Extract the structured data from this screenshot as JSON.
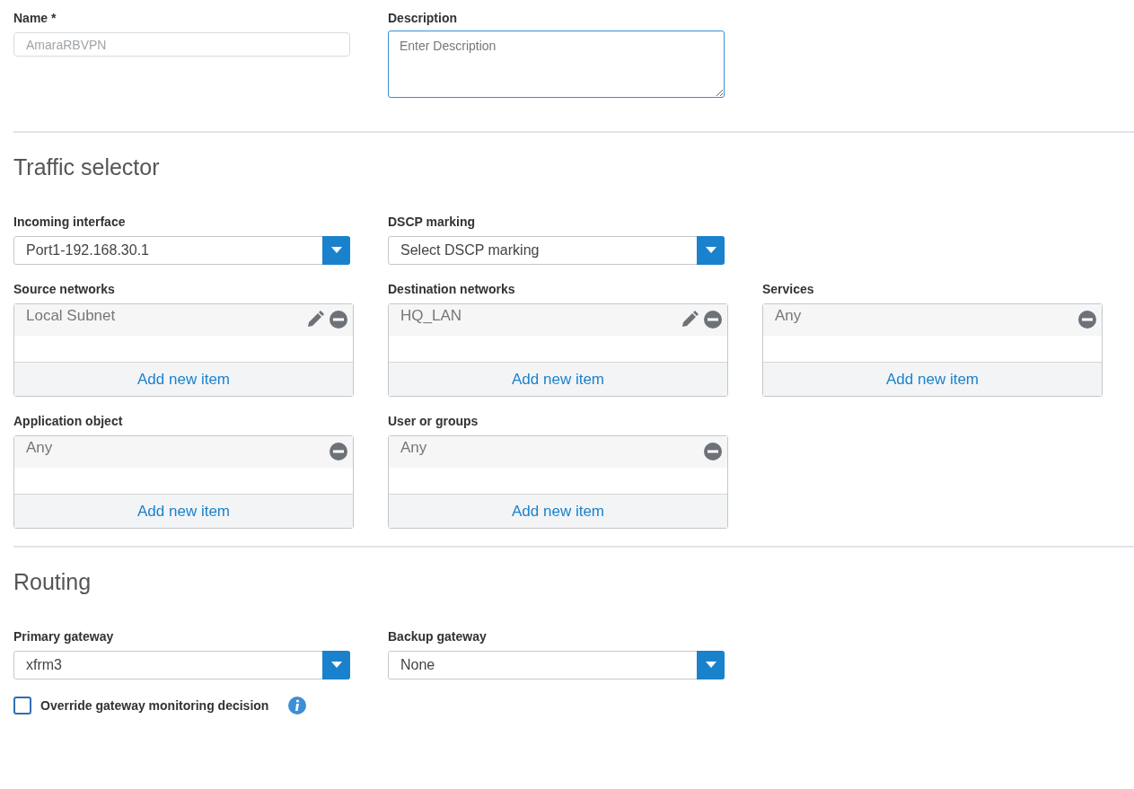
{
  "general": {
    "name": {
      "label": "Name *",
      "value": "AmaraRBVPN",
      "disabled": true
    },
    "description": {
      "label": "Description",
      "placeholder": "Enter Description",
      "focused": true
    }
  },
  "sections": [
    {
      "title": "Traffic selector",
      "rows": [
        [
          {
            "kind": "select",
            "label": "Incoming interface",
            "value": "Port1-192.168.30.1"
          },
          {
            "kind": "select",
            "label": "DSCP marking",
            "value": "Select DSCP marking"
          }
        ],
        [
          {
            "kind": "list",
            "label": "Source networks",
            "items": [
              {
                "text": "Local Subnet",
                "editable": true
              }
            ],
            "add_label": "Add new item"
          },
          {
            "kind": "list",
            "label": "Destination networks",
            "items": [
              {
                "text": "HQ_LAN",
                "editable": true
              }
            ],
            "add_label": "Add new item"
          },
          {
            "kind": "list",
            "label": "Services",
            "items": [
              {
                "text": "Any",
                "editable": false
              }
            ],
            "add_label": "Add new item"
          }
        ],
        [
          {
            "kind": "list",
            "label": "Application object",
            "items": [
              {
                "text": "Any",
                "editable": false
              }
            ],
            "add_label": "Add new item"
          },
          {
            "kind": "list",
            "label": "User or groups",
            "items": [
              {
                "text": "Any",
                "editable": false
              }
            ],
            "add_label": "Add new item"
          }
        ]
      ]
    },
    {
      "title": "Routing",
      "rows": [
        [
          {
            "kind": "select",
            "label": "Primary gateway",
            "value": "xfrm3"
          },
          {
            "kind": "select",
            "label": "Backup gateway",
            "value": "None"
          }
        ]
      ]
    }
  ],
  "override": {
    "label": "Override gateway monitoring decision",
    "checked": false
  }
}
